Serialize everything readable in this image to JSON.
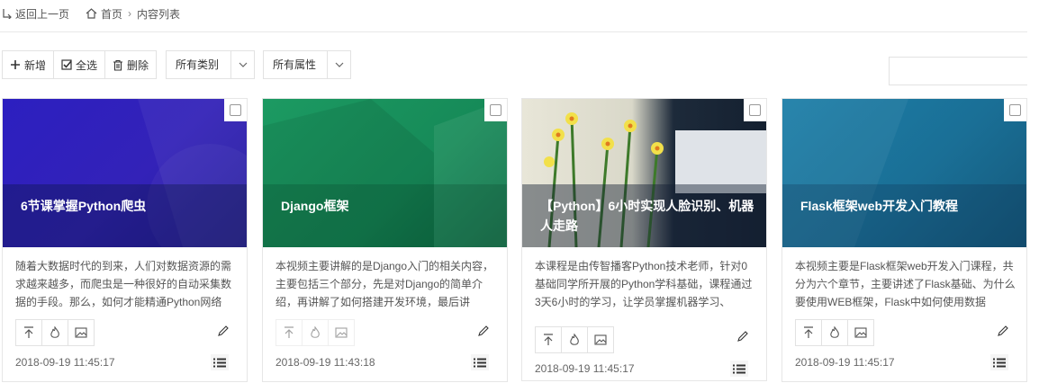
{
  "breadcrumb": {
    "back_label": "返回上一页",
    "home_label": "首页",
    "current_label": "内容列表"
  },
  "toolbar": {
    "add_label": "新增",
    "select_all_label": "全选",
    "delete_label": "删除",
    "category_select": "所有类别",
    "attribute_select": "所有属性"
  },
  "search": {
    "value": "",
    "placeholder": ""
  },
  "cards": [
    {
      "title": "6节课掌握Python爬虫",
      "description": "随着大数据时代的到来，人们对数据资源的需求越来越多，而爬虫是一种很好的自动采集数据的手段。那么，如何才能精通Python网络",
      "date": "2018-09-19 11:45:17",
      "color": "#2a1fb3"
    },
    {
      "title": "Django框架",
      "description": "本视频主要讲解的是Django入门的相关内容，主要包括三个部分，先是对Django的简单介绍，再讲解了如何搭建开发环境，最后讲",
      "date": "2018-09-19 11:43:18",
      "color": "#1a8a5a"
    },
    {
      "title": "【Python】6小时实现人脸识别、机器人走路",
      "description": "本课程是由传智播客Python技术老师，针对0基础同学所开展的Python学科基础，课程通过3天6小时的学习，让学员掌握机器学习、",
      "date": "2018-09-19 11:45:17",
      "color": "#3a4a3a"
    },
    {
      "title": "Flask框架web开发入门教程",
      "description": "本视频主要是Flask框架web开发入门课程，共分为六个章节，主要讲述了Flask基础、为什么要使用WEB框架，Flask中如何使用数据",
      "date": "2018-09-19 11:45:17",
      "color": "#1a6f96"
    }
  ]
}
